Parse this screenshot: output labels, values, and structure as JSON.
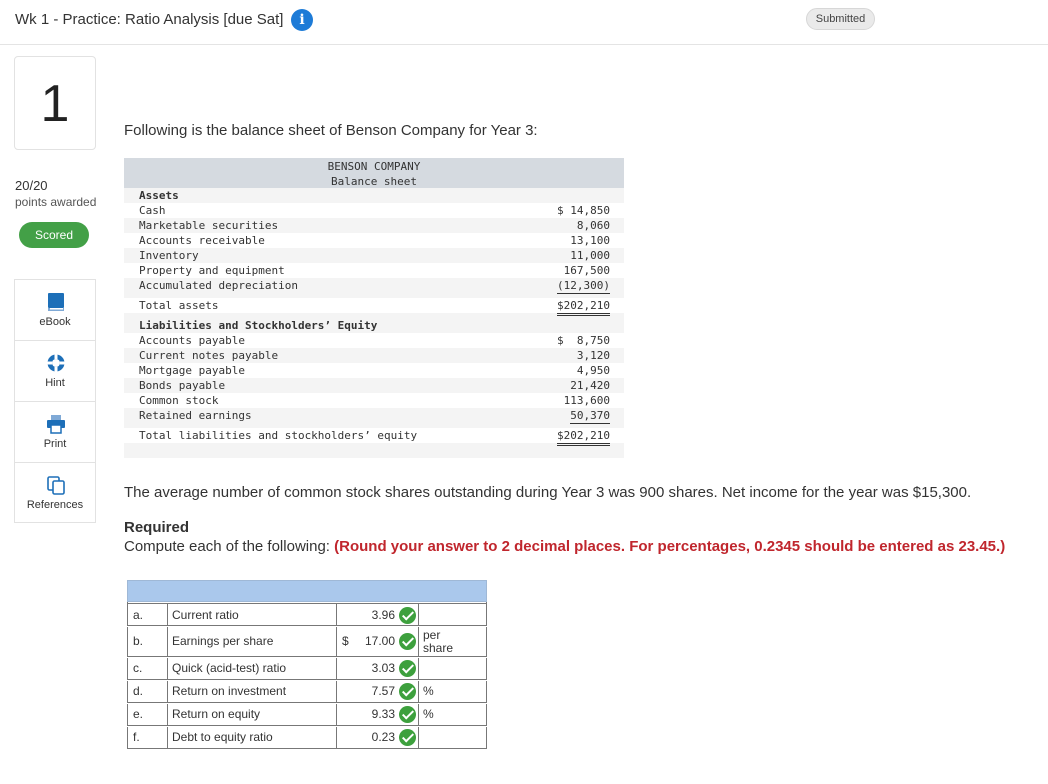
{
  "header": {
    "title": "Wk 1 - Practice: Ratio Analysis [due Sat]",
    "info_icon": "info-icon",
    "status": "Submitted"
  },
  "sidebar": {
    "question_number": "1",
    "score": "20/20",
    "awarded_label": "points awarded",
    "scored_label": "Scored",
    "scored_color": "#43a047",
    "tools": [
      {
        "label": "eBook",
        "icon": "book-icon"
      },
      {
        "label": "Hint",
        "icon": "lifebuoy-icon"
      },
      {
        "label": "Print",
        "icon": "printer-icon"
      },
      {
        "label": "References",
        "icon": "copy-icon"
      }
    ]
  },
  "question": {
    "intro": "Following is the balance sheet of Benson Company for Year 3:",
    "avg_text": "The average number of common stock shares outstanding during Year 3 was 900 shares. Net income for the year was $15,300.",
    "required_label": "Required",
    "compute_text": "Compute each of the following: ",
    "compute_note": "(Round your answer to 2 decimal places. For percentages, 0.2345 should be entered as 23.45.)"
  },
  "balance_sheet": {
    "company": "BENSON COMPANY",
    "subtitle": "Balance sheet",
    "assets_heading": "Assets",
    "assets": [
      {
        "label": "Cash",
        "value": "$ 14,850"
      },
      {
        "label": "Marketable securities",
        "value": "8,060"
      },
      {
        "label": "Accounts receivable",
        "value": "13,100"
      },
      {
        "label": "Inventory",
        "value": "11,000"
      },
      {
        "label": "Property and equipment",
        "value": "167,500"
      },
      {
        "label": "Accumulated depreciation",
        "value": "(12,300)"
      }
    ],
    "total_assets": {
      "label": "Total assets",
      "value": "$202,210"
    },
    "liab_heading": "Liabilities and Stockholders’ Equity",
    "liabilities": [
      {
        "label": "Accounts payable",
        "value": "$  8,750"
      },
      {
        "label": "Current notes payable",
        "value": "3,120"
      },
      {
        "label": "Mortgage payable",
        "value": "4,950"
      },
      {
        "label": "Bonds payable",
        "value": "21,420"
      },
      {
        "label": "Common stock",
        "value": "113,600"
      },
      {
        "label": "Retained earnings",
        "value": "50,370"
      }
    ],
    "total_liab": {
      "label": "Total liabilities and stockholders’ equity",
      "value": "$202,210"
    }
  },
  "answers": [
    {
      "letter": "a.",
      "name": "Current ratio",
      "dollar": "",
      "value": "3.96",
      "unit": ""
    },
    {
      "letter": "b.",
      "name": "Earnings per share",
      "dollar": "$",
      "value": "17.00",
      "unit": "per share"
    },
    {
      "letter": "c.",
      "name": "Quick (acid-test) ratio",
      "dollar": "",
      "value": "3.03",
      "unit": ""
    },
    {
      "letter": "d.",
      "name": "Return on investment",
      "dollar": "",
      "value": "7.57",
      "unit": "%"
    },
    {
      "letter": "e.",
      "name": "Return on equity",
      "dollar": "",
      "value": "9.33",
      "unit": "%"
    },
    {
      "letter": "f.",
      "name": "Debt to equity ratio",
      "dollar": "",
      "value": "0.23",
      "unit": ""
    }
  ]
}
